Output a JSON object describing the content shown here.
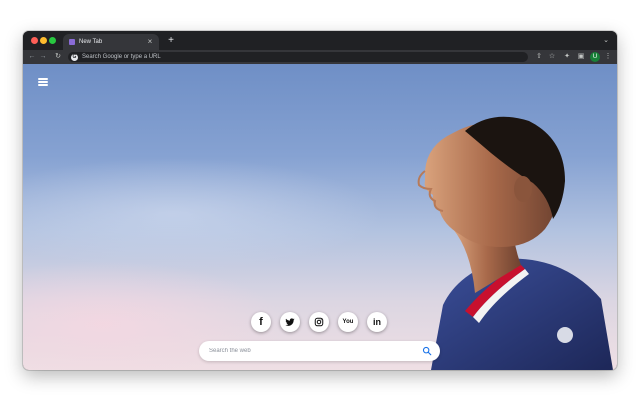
{
  "browser": {
    "tab": {
      "title": "New Tab",
      "close_glyph": "×"
    },
    "new_tab_glyph": "+",
    "tab_search_glyph": "⌄",
    "nav": {
      "back": "←",
      "forward": "→",
      "reload": "↻"
    },
    "omnibox": {
      "placeholder": "Search Google or type a URL",
      "engine_glyph": "G"
    },
    "toolbar": {
      "share_glyph": "⇧",
      "bookmark_glyph": "☆",
      "extensions_glyph": "✦",
      "side_panel_glyph": "▣",
      "profile_initial": "U",
      "menu_glyph": "⋮"
    }
  },
  "page": {
    "menu_icon": "hamburger-icon",
    "background_subject": "footballer-portrait",
    "socials": [
      {
        "icon": "facebook-icon",
        "glyph": "f"
      },
      {
        "icon": "twitter-icon",
        "glyph": ""
      },
      {
        "icon": "instagram-icon",
        "glyph": ""
      },
      {
        "icon": "youtube-icon",
        "glyph": "You"
      },
      {
        "icon": "linkedin-icon",
        "glyph": "in"
      }
    ],
    "search": {
      "placeholder": "Search the web",
      "icon": "search-icon"
    }
  },
  "colors": {
    "accent_blue": "#1a73e8",
    "jersey_navy": "#27346e",
    "profile_green": "#188038"
  }
}
